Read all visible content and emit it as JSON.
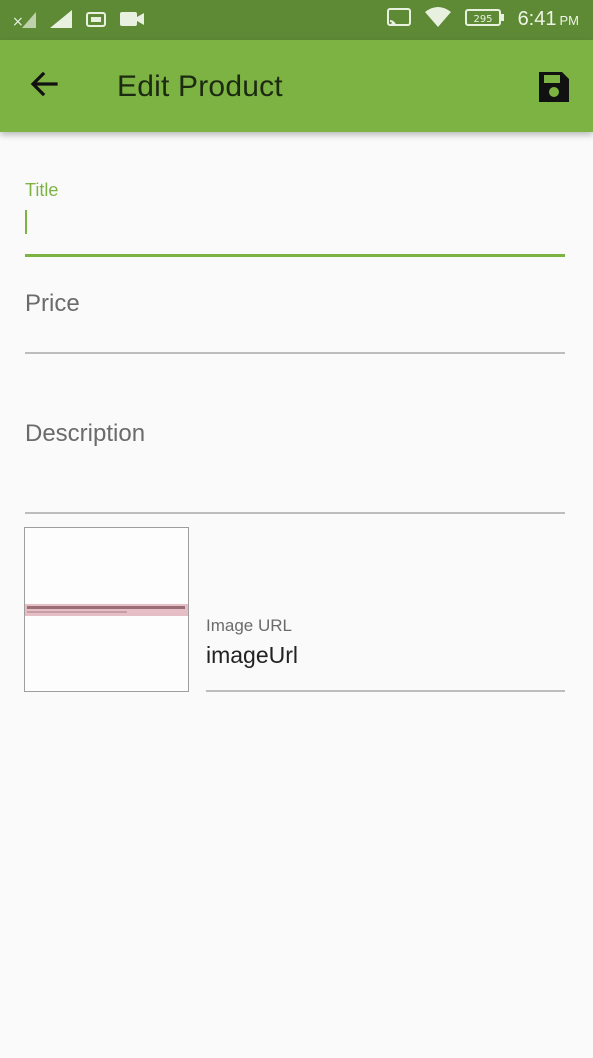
{
  "status_bar": {
    "time": "6:41",
    "ampm": "PM",
    "battery": "295",
    "icons": [
      "signal-off-icon",
      "signal-icon",
      "sim-icon",
      "video-icon",
      "cast-icon",
      "wifi-icon",
      "battery-icon"
    ]
  },
  "app_bar": {
    "title": "Edit Product",
    "back_icon": "arrow-back-icon",
    "save_icon": "save-icon"
  },
  "form": {
    "title_field": {
      "label": "Title",
      "value": ""
    },
    "price_field": {
      "placeholder": "Price"
    },
    "description_field": {
      "placeholder": "Description"
    },
    "image_url_field": {
      "label": "Image URL",
      "value": "imageUrl"
    }
  },
  "colors": {
    "primary": "#7cb342",
    "status_bar": "#5e8a35",
    "background": "#fafafa"
  }
}
